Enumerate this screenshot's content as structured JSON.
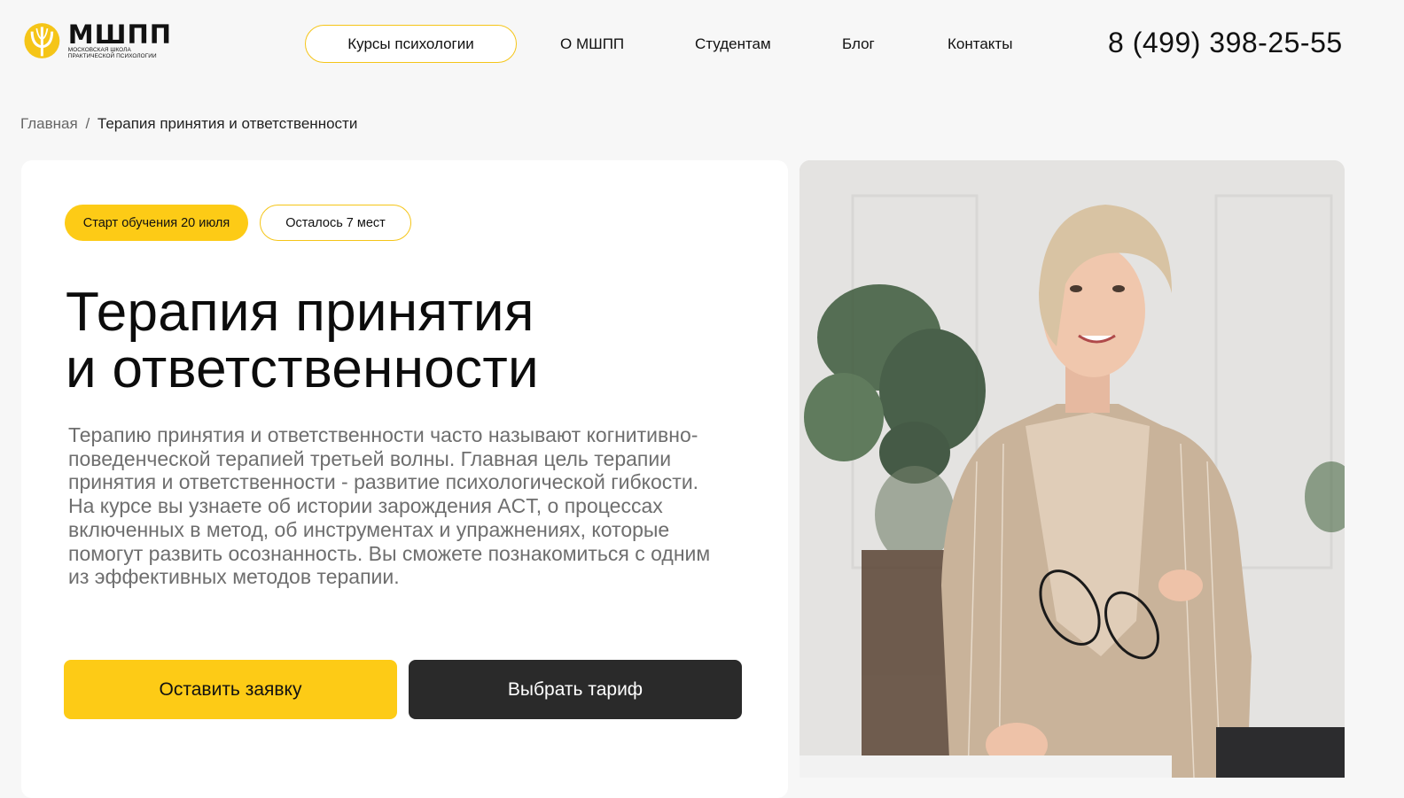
{
  "logo": {
    "title": "МШПП",
    "subtitle_line1": "Московская школа",
    "subtitle_line2": "практической психологии",
    "brand_color": "#F5C518"
  },
  "nav": {
    "courses": "Курсы психологии",
    "about": "О МШПП",
    "students": "Студентам",
    "blog": "Блог",
    "contacts": "Контакты"
  },
  "phone": "8 (499) 398-25-55",
  "breadcrumb": {
    "home": "Главная",
    "separator": "/",
    "current": "Терапия принятия и ответственности"
  },
  "hero": {
    "badge_start": "Старт обучения 20 июля",
    "badge_seats": "Осталось 7 мест",
    "title_line1": "Терапия принятия",
    "title_line2": "и ответственности",
    "description": "Терапию принятия и ответственности часто называют когнитивно-поведенческой терапией третьей волны. Главная цель терапии принятия и ответственности - развитие психологической гибкости. На курсе вы узнаете об истории зарождения ACT, о процессах включенных в метод, об инструментах и упражнениях, которые помогут развить осознанность. Вы сможете познакомиться с одним из эффективных методов терапии.",
    "btn_apply": "Оставить заявку",
    "btn_tariff": "Выбрать тариф"
  },
  "colors": {
    "accent": "#FDCB16",
    "dark_button": "#2A2A2A",
    "page_bg": "#F7F7F7"
  }
}
